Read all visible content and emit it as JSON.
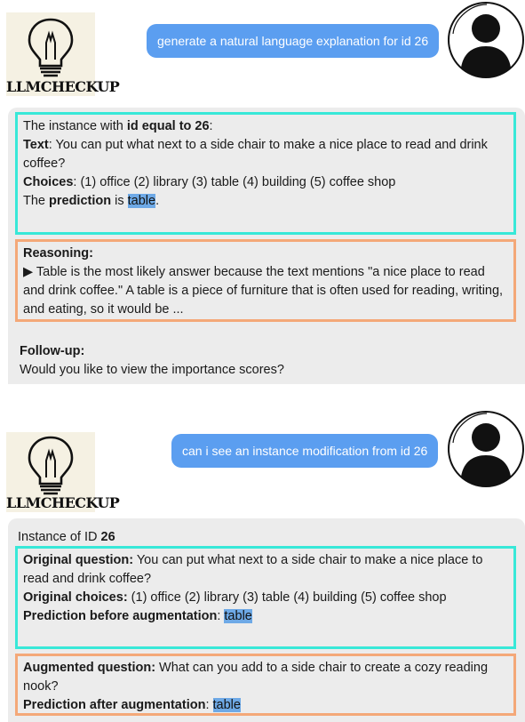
{
  "brand": {
    "name": "LLMCHECKUP"
  },
  "conversation": [
    {
      "user_message": "generate a natural language explanation for id 26",
      "response": {
        "instance_prefix": "The instance with ",
        "instance_bold": "id equal to 26",
        "instance_suffix": ":",
        "text_label": "Text",
        "text_value": ": You can put what next to a side chair to make a nice place to read and drink coffee?",
        "choices_label": "Choices",
        "choices_value": ": (1) office (2) library (3) table (4) building (5) coffee shop",
        "prediction_prefix": "The ",
        "prediction_bold": "prediction",
        "prediction_mid": " is ",
        "prediction_value": "table",
        "prediction_end": ".",
        "reasoning_label": "Reasoning:",
        "reasoning_text": "▶ Table is the most likely answer because the text mentions \"a nice place to read and drink coffee.\" A table is a piece of furniture that is often used for reading, writing, and eating, so it would be ...",
        "followup_label": "Follow-up:",
        "followup_text": "Would you like to view the importance scores?"
      }
    },
    {
      "user_message": "can i see an instance modification from id 26",
      "response": {
        "instance_prefix": "Instance of ID ",
        "instance_id": "26",
        "orig_q_label": "Original question:",
        "orig_q_value": " You can put what next to a side chair to make a nice place to read and drink coffee?",
        "orig_c_label": "Original choices:",
        "orig_c_value": " (1) office (2) library (3) table (4) building (5) coffee shop",
        "pred_before_label": "Prediction before augmentation",
        "pred_before_value": "table",
        "aug_q_label": "Augmented question:",
        "aug_q_value": " What can you add to a side chair to create a cozy reading nook?",
        "pred_after_label": "Prediction after augmentation",
        "pred_after_value": "table"
      }
    }
  ],
  "icons": [
    "lightbulb-icon",
    "user-avatar-icon"
  ],
  "colors": {
    "bubble": "#5b9ef0",
    "cyan_border": "#38e8d8",
    "orange_border": "#f4a878",
    "card_bg": "#ececec",
    "highlight": "#6ea9e6"
  }
}
